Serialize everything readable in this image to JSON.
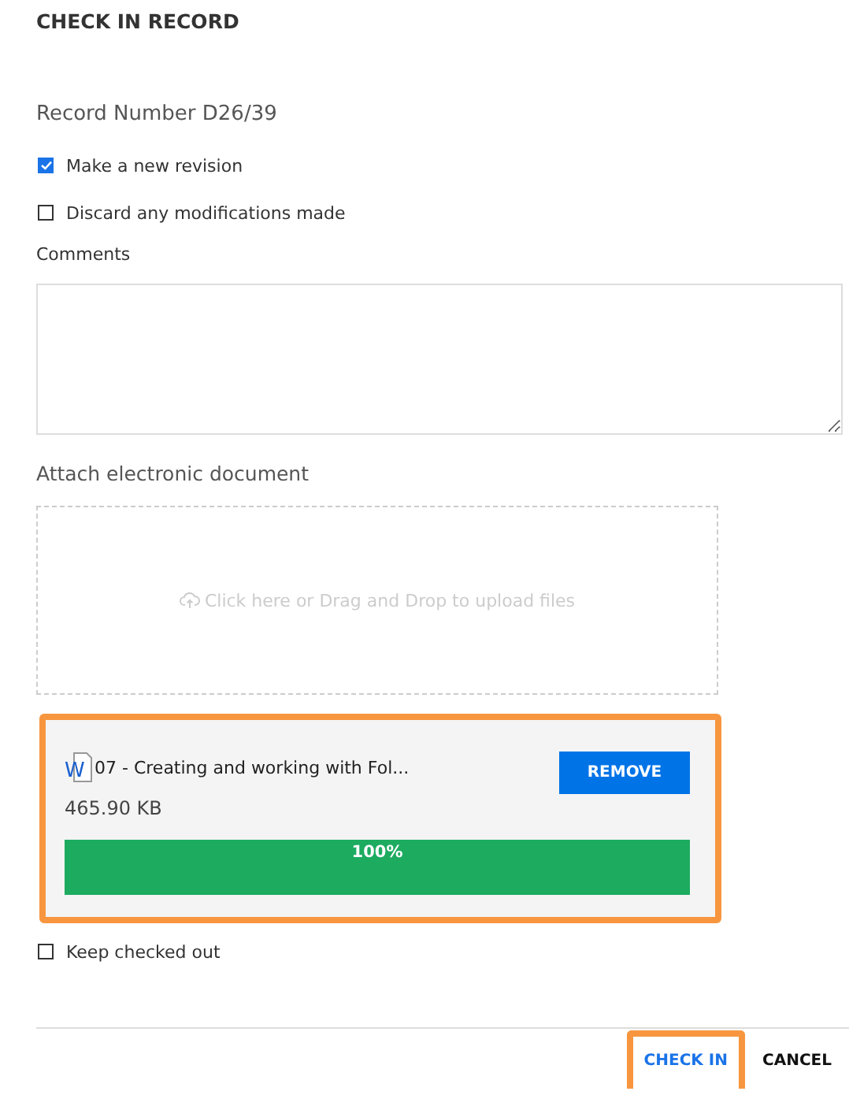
{
  "title": "CHECK IN RECORD",
  "record_number": "Record Number D26/39",
  "options": [
    {
      "label": "Make a new revision",
      "checked": true
    },
    {
      "label": "Discard any modifications made",
      "checked": false
    }
  ],
  "comments": {
    "label": "Comments"
  },
  "attach": {
    "label": "Attach electronic document",
    "dropzone_text": "Click here or Drag and Drop to upload files"
  },
  "file": {
    "icon_letter": "W",
    "name": "07 - Creating and working with Fol...",
    "size": "465.90 KB",
    "remove": "REMOVE",
    "progress": "100%",
    "level": 1,
    "highlighted": true
  },
  "keep_checked_out": {
    "label": "Keep checked out",
    "checked": false
  },
  "buttons": [
    {
      "label": "CHECK IN",
      "kind": "primary",
      "highlighted": true
    },
    {
      "label": "CANCEL",
      "kind": "secondary",
      "highlighted": false
    }
  ]
}
